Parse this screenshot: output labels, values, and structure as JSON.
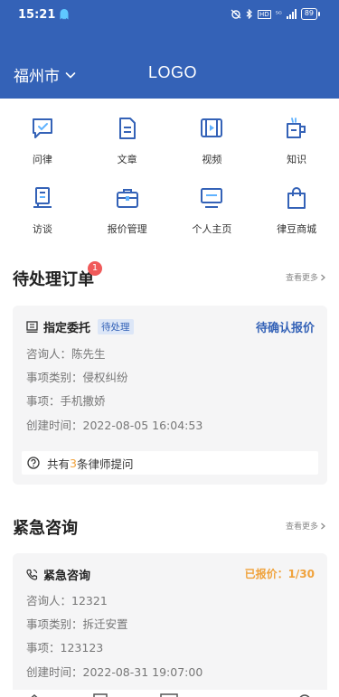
{
  "status_bar": {
    "time": "15:21",
    "signal_text": "⁵ᴳ",
    "hd_text": "HD",
    "battery": "89"
  },
  "header": {
    "city": "福州市",
    "logo": "LOGO"
  },
  "grid": [
    {
      "label": "问律",
      "icon": "chat-icon"
    },
    {
      "label": "文章",
      "icon": "document-icon"
    },
    {
      "label": "视频",
      "icon": "film-icon"
    },
    {
      "label": "知识",
      "icon": "book-icon"
    },
    {
      "label": "访谈",
      "icon": "interview-icon"
    },
    {
      "label": "报价管理",
      "icon": "briefcase-icon"
    },
    {
      "label": "个人主页",
      "icon": "monitor-icon"
    },
    {
      "label": "律豆商城",
      "icon": "shopping-bag-icon"
    }
  ],
  "pending_orders": {
    "title": "待处理订单",
    "badge": "1",
    "more": "查看更多",
    "card": {
      "type": "指定委托",
      "tag": "待处理",
      "status": "待确认报价",
      "rows": [
        {
          "label": "咨询人：",
          "value": "陈先生"
        },
        {
          "label": "事项类别：",
          "value": "侵权纠纷"
        },
        {
          "label": "事项：",
          "value": "手机撒娇"
        },
        {
          "label": "创建时间：",
          "value": "2022-08-05 16:04:53"
        }
      ],
      "question_prefix": "共有",
      "question_count": "3",
      "question_suffix": "条律师提问"
    }
  },
  "urgent": {
    "title": "紧急咨询",
    "more": "查看更多",
    "card": {
      "type": "紧急咨询",
      "status": "已报价：1/30",
      "rows": [
        {
          "label": "咨询人：",
          "value": "12321"
        },
        {
          "label": "事项类别：",
          "value": "拆迁安置"
        },
        {
          "label": "事项：",
          "value": "123123"
        },
        {
          "label": "创建时间：",
          "value": "2022-08-31 19:07:00"
        }
      ]
    }
  },
  "colors": {
    "brand": "#3462b7",
    "accent_orange": "#f0a23b",
    "badge_red": "#f05a5a",
    "card_bg": "#f5f5f6"
  }
}
